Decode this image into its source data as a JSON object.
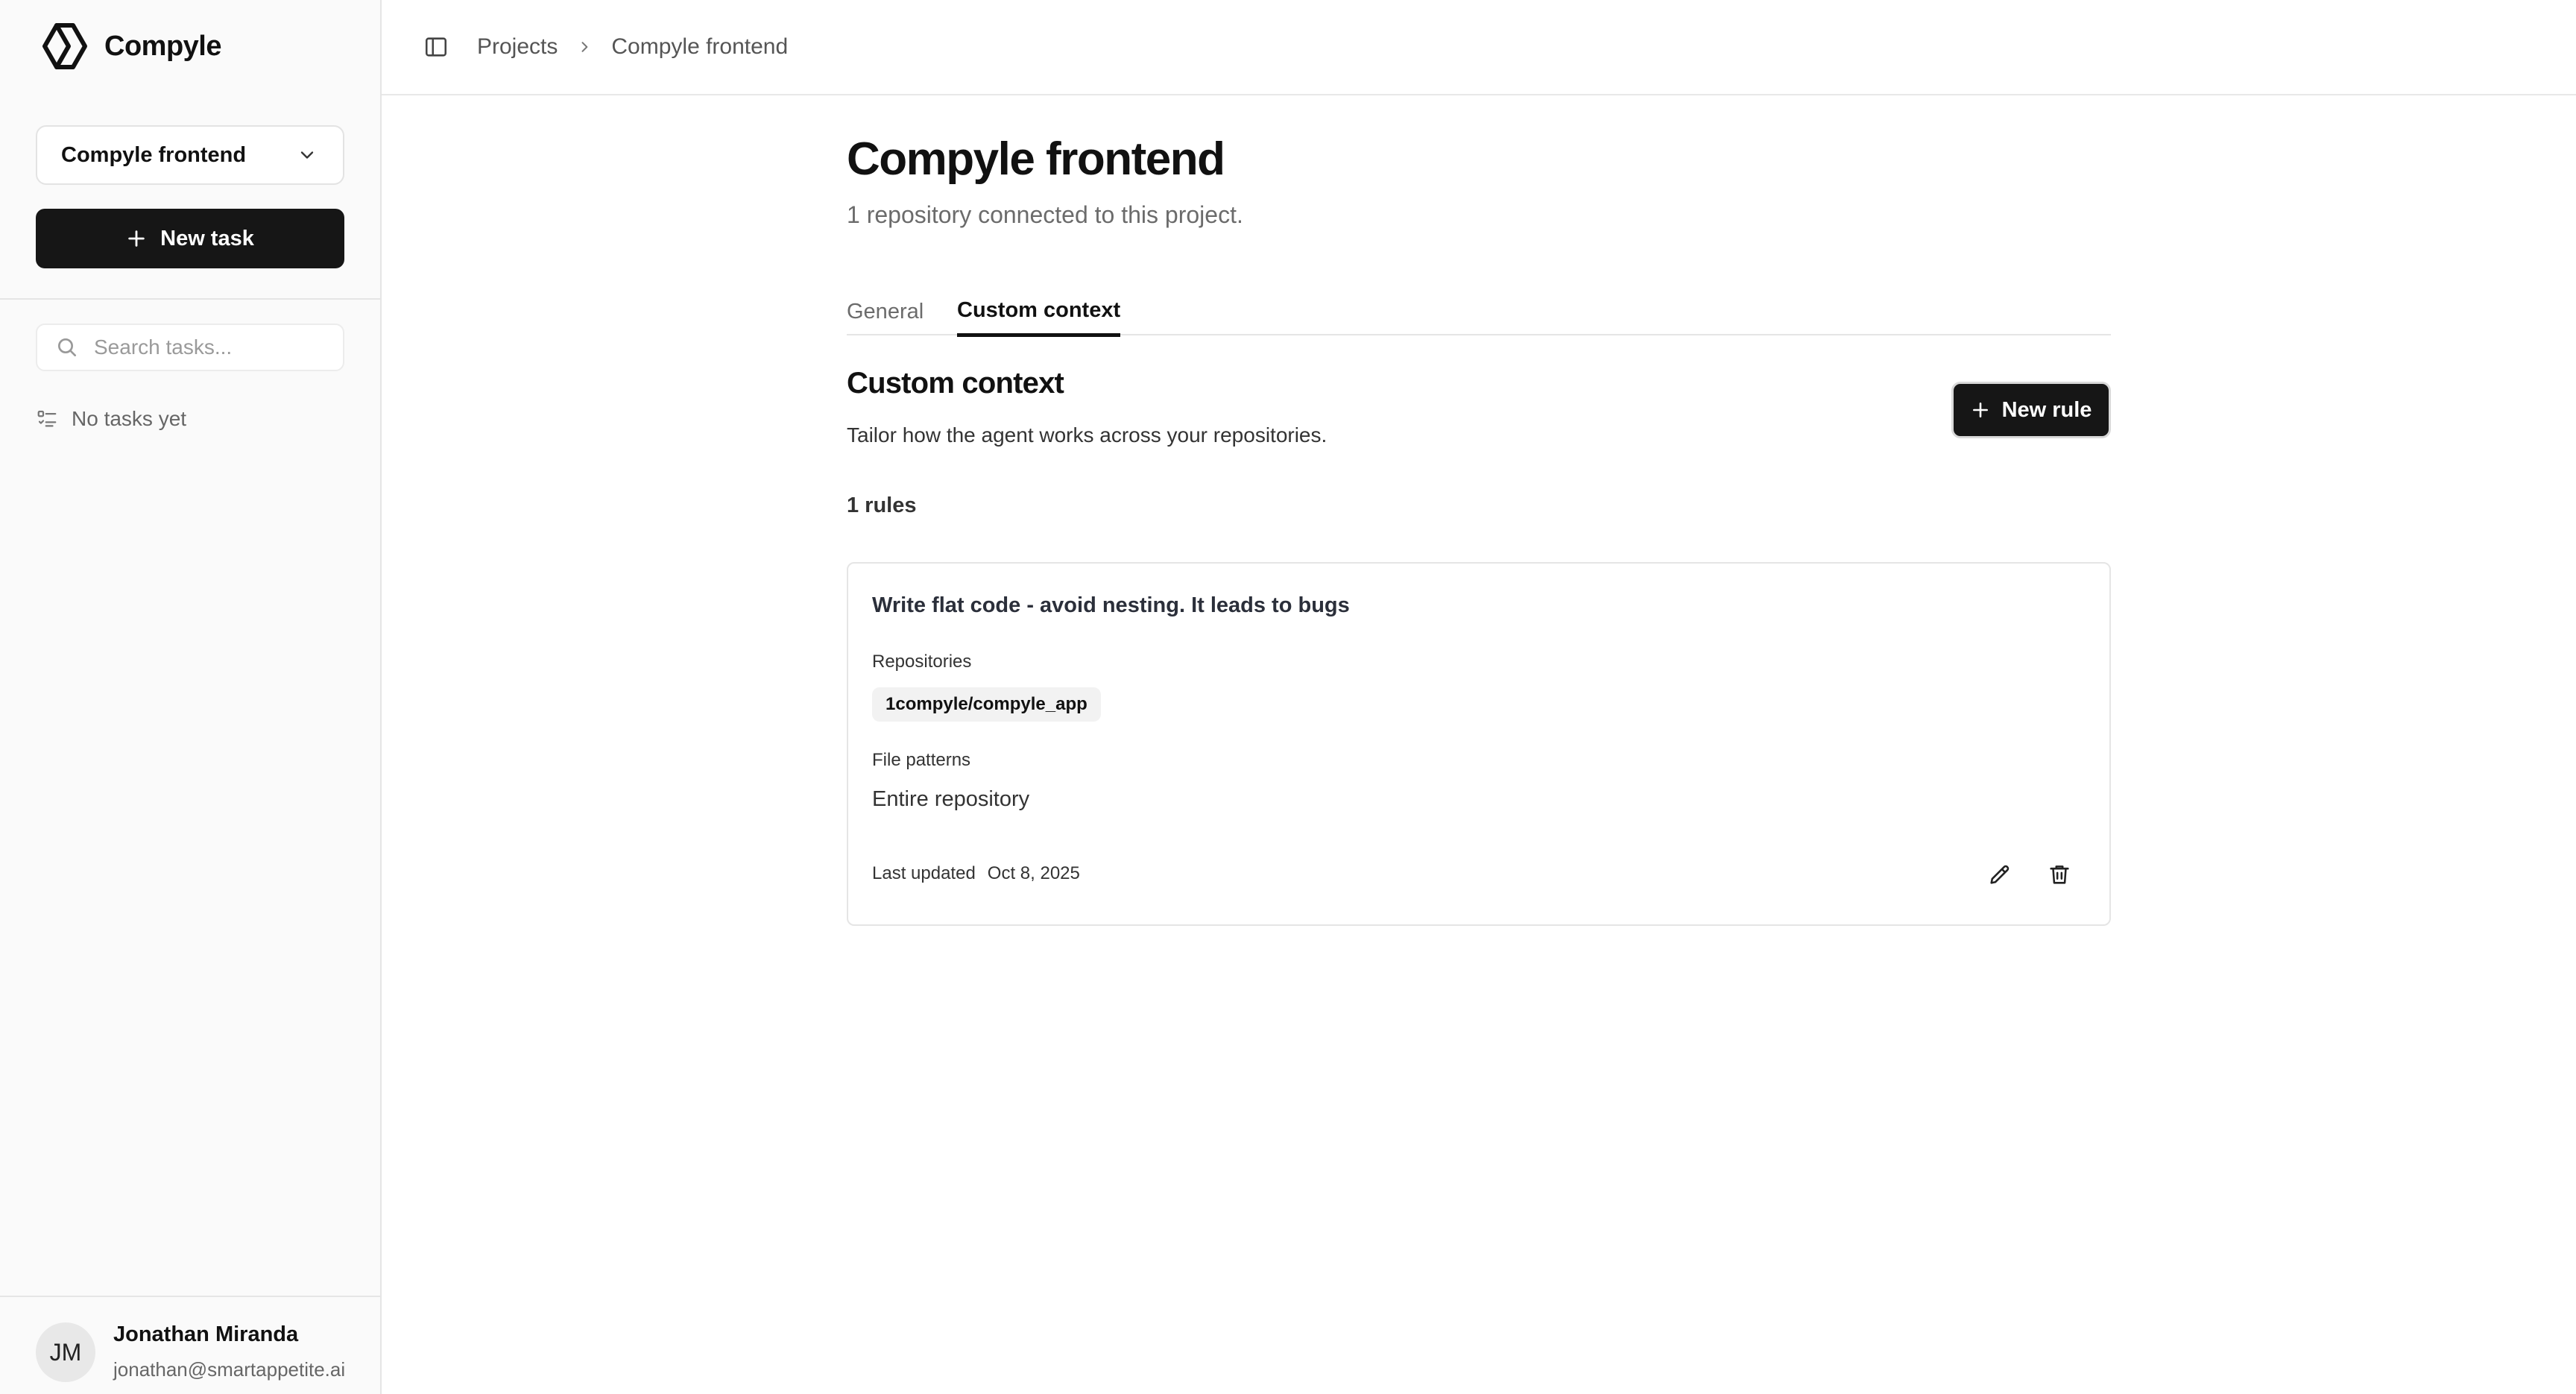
{
  "app": {
    "name": "Compyle"
  },
  "sidebar": {
    "project_selector": {
      "selected": "Compyle frontend"
    },
    "new_task_label": "New task",
    "search": {
      "placeholder": "Search tasks...",
      "value": ""
    },
    "empty_tasks_label": "No tasks yet",
    "user": {
      "initials": "JM",
      "name": "Jonathan Miranda",
      "email": "jonathan@smartappetite.ai"
    }
  },
  "breadcrumb": {
    "items": [
      "Projects",
      "Compyle frontend"
    ]
  },
  "page": {
    "title": "Compyle frontend",
    "subtitle": "1 repository connected to this project.",
    "tabs": [
      {
        "label": "General",
        "active": false
      },
      {
        "label": "Custom context",
        "active": true
      }
    ]
  },
  "custom_context": {
    "title": "Custom context",
    "description": "Tailor how the agent works across your repositories.",
    "new_rule_label": "New rule",
    "rules_count_label": "1 rules",
    "rules": [
      {
        "title": "Write flat code - avoid nesting. It leads to bugs",
        "repositories_label": "Repositories",
        "repositories": [
          "1compyle/compyle_app"
        ],
        "file_patterns_label": "File patterns",
        "file_patterns_value": "Entire repository",
        "last_updated_label": "Last updated",
        "last_updated_value": "Oct 8, 2025"
      }
    ]
  },
  "icons": {
    "logo": "compyle-logo-icon",
    "select": "chevron-down-icon",
    "add": "plus-icon",
    "search": "search-icon",
    "tasks": "task-list-icon",
    "panel": "sidebar-toggle-icon",
    "separator": "chevron-right-icon",
    "edit": "pencil-icon",
    "delete": "trash-icon"
  },
  "colors": {
    "primary_button": "#161616",
    "sidebar_background": "#fafafa",
    "border": "#e5e5e5",
    "muted_text": "#6b6b6b"
  }
}
